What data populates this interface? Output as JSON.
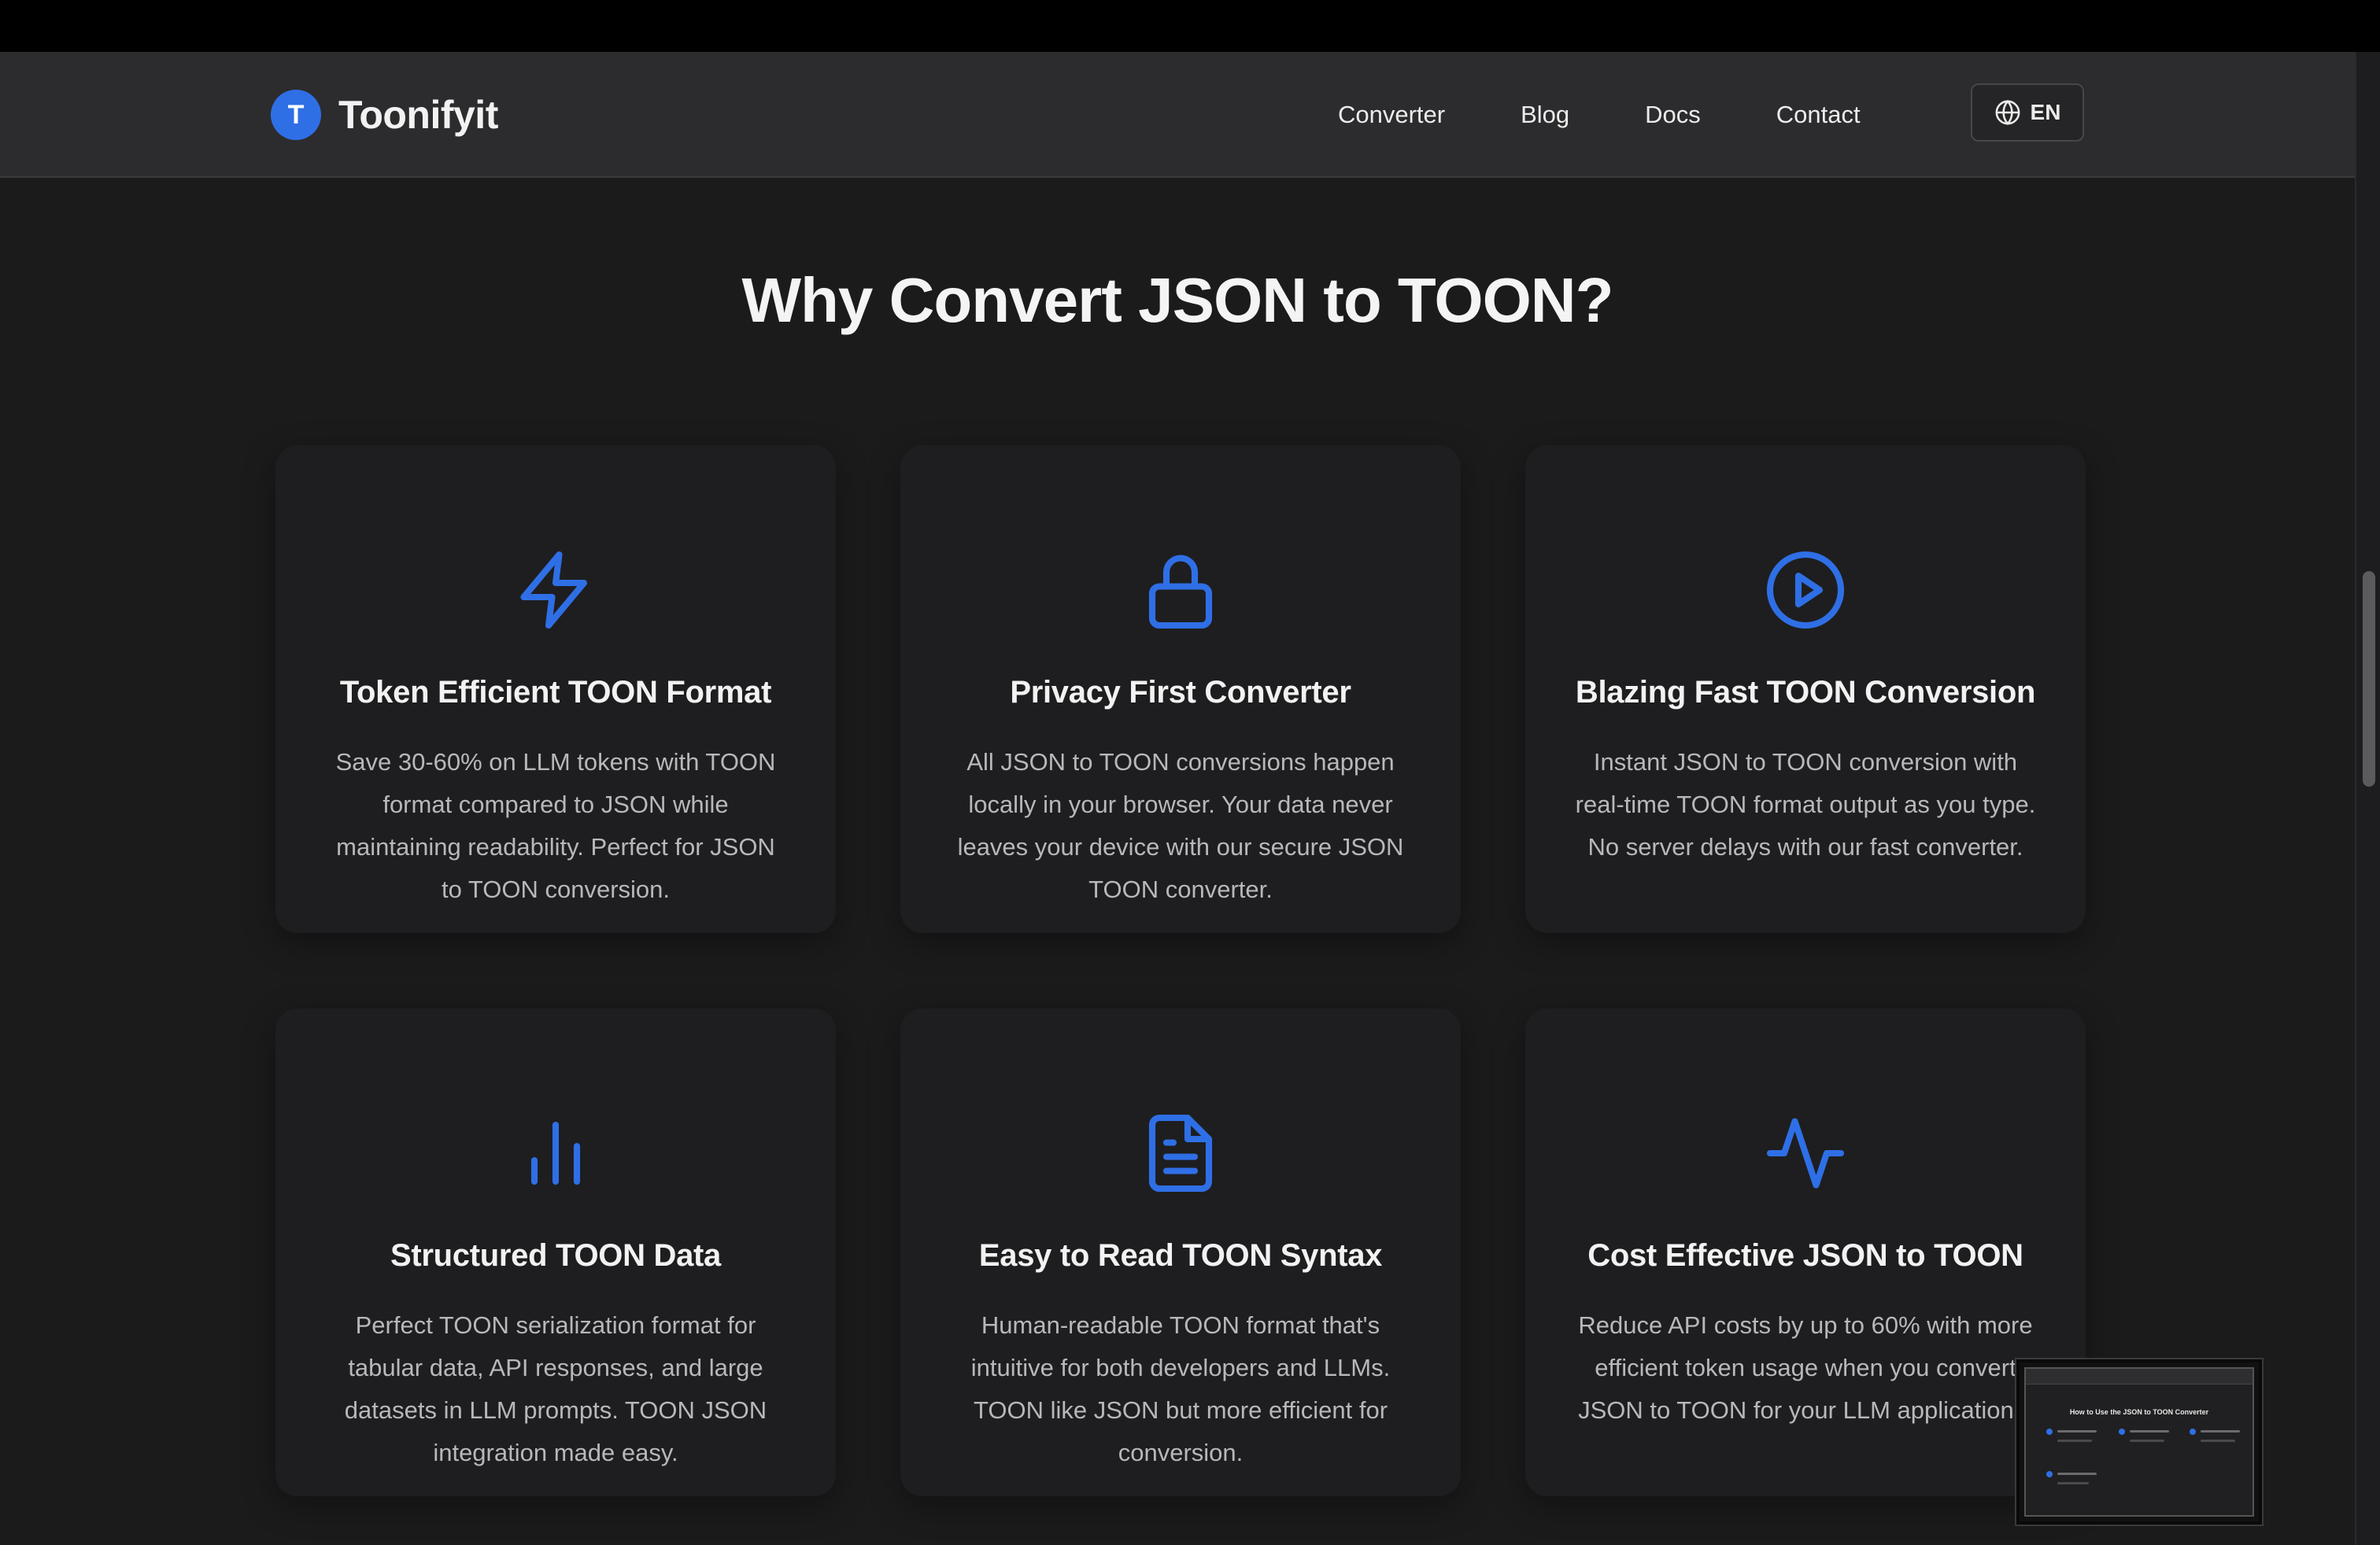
{
  "brand": {
    "logo_letter": "T",
    "name": "Toonifyit",
    "accent": "#2f6fe6"
  },
  "nav": {
    "items": [
      "Converter",
      "Blog",
      "Docs",
      "Contact"
    ],
    "language": "EN"
  },
  "section": {
    "title": "Why Convert JSON to TOON?"
  },
  "features": [
    {
      "icon": "lightning-icon",
      "title": "Token Efficient TOON Format",
      "desc": "Save 30-60% on LLM tokens with TOON format compared to JSON while maintaining readability. Perfect for JSON to TOON conversion."
    },
    {
      "icon": "lock-icon",
      "title": "Privacy First Converter",
      "desc": "All JSON to TOON conversions happen locally in your browser. Your data never leaves your device with our secure JSON TOON converter."
    },
    {
      "icon": "play-circle-icon",
      "title": "Blazing Fast TOON Conversion",
      "desc": "Instant JSON to TOON conversion with real-time TOON format output as you type. No server delays with our fast converter."
    },
    {
      "icon": "bar-chart-icon",
      "title": "Structured TOON Data",
      "desc": "Perfect TOON serialization format for tabular data, API responses, and large datasets in LLM prompts. TOON JSON integration made easy."
    },
    {
      "icon": "document-icon",
      "title": "Easy to Read TOON Syntax",
      "desc": "Human-readable TOON format that's intuitive for both developers and LLMs. TOON like JSON but more efficient for conversion."
    },
    {
      "icon": "activity-icon",
      "title": "Cost Effective JSON to TOON",
      "desc": "Reduce API costs by up to 60% with more efficient token usage when you convert JSON to TOON for your LLM applications."
    }
  ],
  "thumbnail": {
    "title": "How to Use the JSON to TOON Converter"
  }
}
